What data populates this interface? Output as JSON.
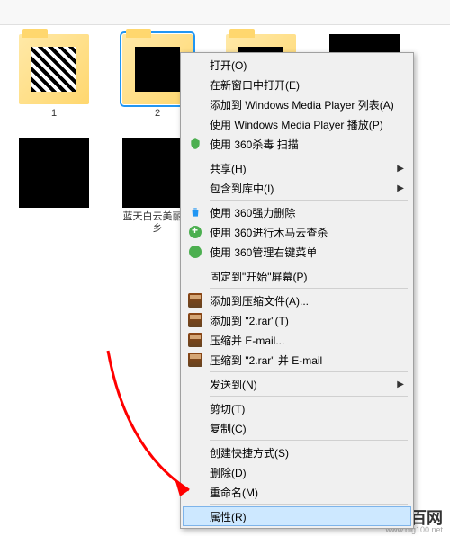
{
  "files": [
    {
      "label": "1",
      "type": "folder-qr"
    },
    {
      "label": "2",
      "type": "folder-black",
      "selected": true
    },
    {
      "label": "",
      "type": "folder-black"
    },
    {
      "label": "",
      "type": "black"
    },
    {
      "label": "",
      "type": "black"
    },
    {
      "label": "蓝天白云美丽家乡",
      "type": "black"
    }
  ],
  "menu": {
    "open": "打开(O)",
    "open_new_window": "在新窗口中打开(E)",
    "add_wmp_list": "添加到 Windows Media Player 列表(A)",
    "play_wmp": "使用 Windows Media Player 播放(P)",
    "scan_360": "使用 360杀毒 扫描",
    "share": "共享(H)",
    "include_library": "包含到库中(I)",
    "force_delete_360": "使用 360强力删除",
    "trojan_360": "使用 360进行木马云查杀",
    "manage_menu_360": "使用 360管理右键菜单",
    "pin_start": "固定到\"开始\"屏幕(P)",
    "add_archive": "添加到压缩文件(A)...",
    "add_2rar": "添加到 \"2.rar\"(T)",
    "compress_email": "压缩并 E-mail...",
    "compress_2rar_email": "压缩到 \"2.rar\" 并 E-mail",
    "send_to": "发送到(N)",
    "cut": "剪切(T)",
    "copy": "复制(C)",
    "create_shortcut": "创建快捷方式(S)",
    "delete": "删除(D)",
    "rename": "重命名(M)",
    "properties": "属性(R)"
  },
  "watermark": {
    "text": "大百网",
    "url": "www.big100.net",
    "colors": [
      "#ff6b35",
      "#4ecdc4",
      "#ffd93d",
      "#6bcf7f"
    ]
  }
}
